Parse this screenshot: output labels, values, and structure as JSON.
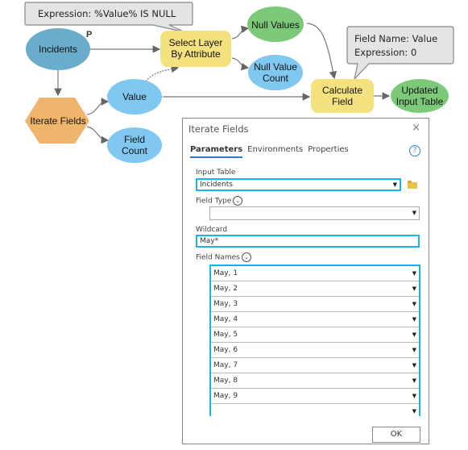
{
  "model": {
    "nodes": {
      "incidents": {
        "label": "Incidents",
        "parameter_marker": "P"
      },
      "iterate_fields": {
        "label": "Iterate Fields"
      },
      "value": {
        "label": "Value"
      },
      "field_count": {
        "line1": "Field",
        "line2": "Count"
      },
      "select_layer": {
        "line1": "Select Layer",
        "line2": "By Attribute"
      },
      "null_values": {
        "label": "Null Values"
      },
      "null_value_count": {
        "line1": "Null Value",
        "line2": "Count"
      },
      "calculate_field": {
        "line1": "Calculate",
        "line2": "Field"
      },
      "updated_input_table": {
        "line1": "Updated",
        "line2": "Input Table"
      }
    },
    "callouts": {
      "select_expression": "Expression: %Value% IS NULL",
      "calc_field_name": "Field Name: Value",
      "calc_expression": "Expression: 0"
    },
    "colors": {
      "data_dark": "#6aaccc",
      "data_light": "#80c8ef",
      "tool_yellow": "#f4e27f",
      "output_green": "#7cc97a",
      "iterator_orange": "#f0b56c",
      "callout_fill": "#e4e4e4"
    }
  },
  "dialog": {
    "title": "Iterate Fields",
    "close": "×",
    "tabs": [
      "Parameters",
      "Environments",
      "Properties"
    ],
    "active_tab": "Parameters",
    "help": "?",
    "input_table": {
      "label": "Input Table",
      "value": "Incidents"
    },
    "field_type": {
      "label": "Field Type",
      "value": ""
    },
    "wildcard": {
      "label": "Wildcard",
      "value": "May*"
    },
    "field_names": {
      "label": "Field Names",
      "values": [
        "May, 1",
        "May, 2",
        "May, 3",
        "May, 4",
        "May, 5",
        "May, 6",
        "May, 7",
        "May, 8",
        "May, 9",
        ""
      ]
    },
    "ok_label": "OK"
  }
}
